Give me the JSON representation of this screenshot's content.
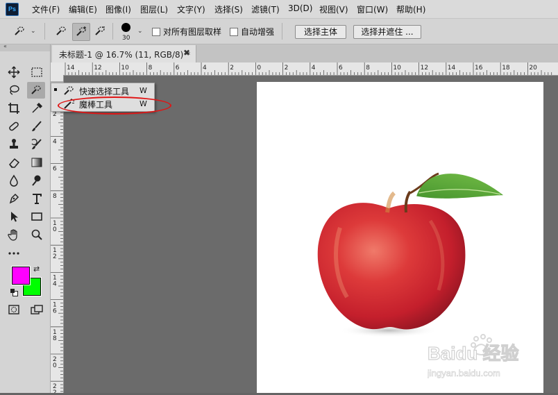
{
  "app": {
    "logo_text": "Ps"
  },
  "menu": [
    "文件(F)",
    "编辑(E)",
    "图像(I)",
    "图层(L)",
    "文字(Y)",
    "选择(S)",
    "滤镜(T)",
    "3D(D)",
    "视图(V)",
    "窗口(W)",
    "帮助(H)"
  ],
  "options_bar": {
    "brush_size": "30",
    "sample_all_layers_label": "对所有图层取样",
    "auto_enhance_label": "自动增强",
    "select_subject_label": "选择主体",
    "select_and_mask_label": "选择并遮住 ..."
  },
  "document_tab": {
    "title": "未标题-1 @ 16.7% (11, RGB/8) *",
    "close": "✖"
  },
  "rulers": {
    "horizontal_ticks": [
      "14",
      "12",
      "10",
      "8",
      "6",
      "4",
      "2",
      "0",
      "2",
      "4",
      "6",
      "8",
      "10",
      "12",
      "14",
      "16",
      "18",
      "20"
    ],
    "vertical_ticks": [
      "0",
      "2",
      "4",
      "6",
      "8",
      "1\n0",
      "1\n2",
      "1\n4",
      "1\n6",
      "1\n8",
      "2\n0",
      "2\n2"
    ]
  },
  "flyout": {
    "items": [
      {
        "label": "快速选择工具",
        "shortcut": "W",
        "icon": "quick-selection-icon",
        "active": true
      },
      {
        "label": "魔棒工具",
        "shortcut": "W",
        "icon": "magic-wand-icon",
        "active": false
      }
    ]
  },
  "colors": {
    "foreground": "#ff00ff",
    "background": "#00ff00",
    "annotation": "#e01515"
  },
  "watermark": {
    "logo": "Baidu 经验",
    "url": "jingyan.baidu.com"
  }
}
